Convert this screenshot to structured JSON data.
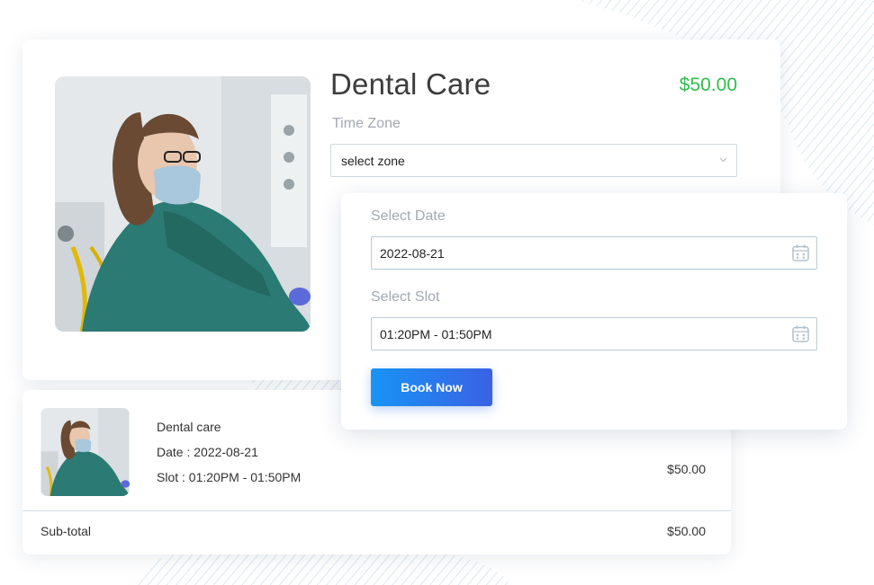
{
  "service": {
    "title": "Dental Care",
    "price": "$50.00",
    "photo_icon": "dental-nurse-photo"
  },
  "timezone": {
    "label": "Time Zone",
    "value": "select zone"
  },
  "booking": {
    "date_label": "Select Date",
    "date_value": "2022-08-21",
    "slot_label": "Select Slot",
    "slot_value": "01:20PM - 01:50PM",
    "button": "Book Now"
  },
  "cart": {
    "item_name": "Dental care",
    "item_date": "Date : 2022-08-21",
    "item_slot": "Slot : 01:20PM - 01:50PM",
    "item_price": "$50.00",
    "subtotal_label": "Sub-total",
    "subtotal_value": "$50.00"
  },
  "colors": {
    "price_green": "#2fbe4c",
    "button_gradient_start": "#1894f5",
    "button_gradient_end": "#3a61e4",
    "label_gray": "#a3a9b3"
  }
}
